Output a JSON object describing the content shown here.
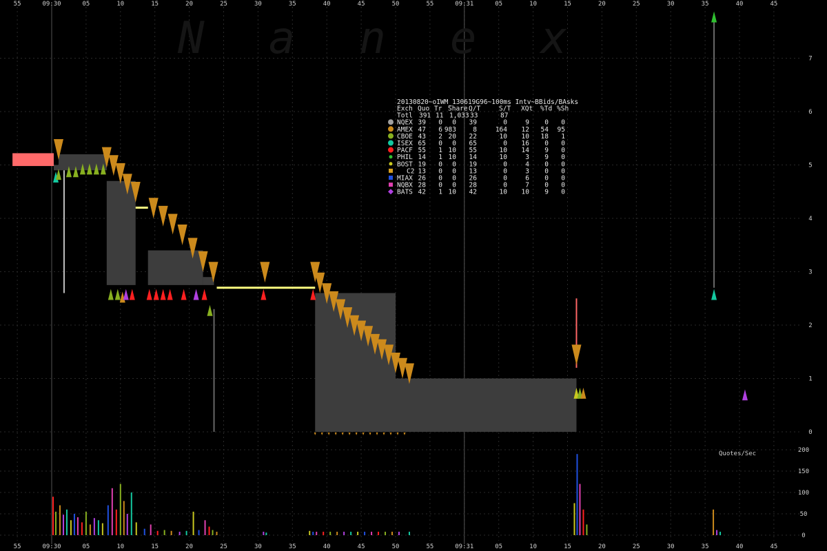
{
  "chart_data": {
    "type": "table",
    "watermark": "N a n e x",
    "time_axis": {
      "labels": [
        "55",
        "09:30",
        "05",
        "10",
        "15",
        "20",
        "25",
        "30",
        "35",
        "40",
        "45",
        "50",
        "55",
        "09:31",
        "05",
        "10",
        "15",
        "20",
        "25",
        "30",
        "35",
        "40",
        "45"
      ],
      "minor_labels_seconds": [
        -5,
        0,
        5,
        10,
        15,
        20,
        25,
        30,
        35,
        40,
        45,
        50,
        55,
        60,
        65,
        70,
        75,
        80,
        85,
        90,
        95,
        100,
        105
      ],
      "range_seconds": [
        -7,
        112
      ],
      "minute_markers": [
        0,
        60
      ]
    },
    "price_axis": {
      "ticks": [
        "0",
        "1",
        "2",
        "3",
        "4",
        "5",
        "6",
        "7"
      ],
      "range": [
        0,
        7.8
      ]
    },
    "rate_axis": {
      "title": "Quotes/Sec",
      "ticks": [
        "0",
        "50",
        "100",
        "150",
        "200"
      ],
      "range": [
        0,
        205
      ]
    },
    "legend": {
      "title": "20130820~oIWM_130619G96~100ms Intv~BBids/BAsks",
      "header": [
        "Exch",
        "Quo",
        "Tr",
        "Share",
        "Q/T",
        "S/T",
        "XQt",
        "%Td",
        "%Sh"
      ],
      "total_row": [
        "Totl",
        "391",
        "11",
        "1,033",
        "33",
        "87",
        "",
        "",
        ""
      ],
      "rows": [
        {
          "exch": "NQEX",
          "cells": [
            "39",
            "0",
            "0",
            "39",
            "0",
            "9",
            "0",
            "0"
          ],
          "color": "#a0a0a0",
          "marker": "circle"
        },
        {
          "exch": "AMEX",
          "cells": [
            "47",
            "6",
            "983",
            "8",
            "164",
            "12",
            "54",
            "95"
          ],
          "color": "#cc8a1c",
          "marker": "circle"
        },
        {
          "exch": "CBOE",
          "cells": [
            "43",
            "2",
            "20",
            "22",
            "10",
            "10",
            "18",
            "1"
          ],
          "color": "#88b020",
          "marker": "circle"
        },
        {
          "exch": "ISEX",
          "cells": [
            "65",
            "0",
            "0",
            "65",
            "0",
            "16",
            "0",
            "0"
          ],
          "color": "#14c8a0",
          "marker": "circle"
        },
        {
          "exch": "PACF",
          "cells": [
            "55",
            "1",
            "10",
            "55",
            "10",
            "14",
            "9",
            "0"
          ],
          "color": "#ff2020",
          "marker": "circle"
        },
        {
          "exch": "PHIL",
          "cells": [
            "14",
            "1",
            "10",
            "14",
            "10",
            "3",
            "9",
            "0"
          ],
          "color": "#30c030",
          "marker": "dot"
        },
        {
          "exch": "BOST",
          "cells": [
            "19",
            "0",
            "0",
            "19",
            "0",
            "4",
            "0",
            "0"
          ],
          "color": "#c8c820",
          "marker": "dot"
        },
        {
          "exch": "C2",
          "cells": [
            "13",
            "0",
            "0",
            "13",
            "0",
            "3",
            "0",
            "0"
          ],
          "color": "#d8a020",
          "marker": "square"
        },
        {
          "exch": "MIAX",
          "cells": [
            "26",
            "0",
            "0",
            "26",
            "0",
            "6",
            "0",
            "0"
          ],
          "color": "#2050e0",
          "marker": "square"
        },
        {
          "exch": "NQBX",
          "cells": [
            "28",
            "0",
            "0",
            "28",
            "0",
            "7",
            "0",
            "0"
          ],
          "color": "#e040b0",
          "marker": "square"
        },
        {
          "exch": "BATS",
          "cells": [
            "42",
            "1",
            "10",
            "42",
            "10",
            "10",
            "9",
            "0"
          ],
          "color": "#b040e0",
          "marker": "diamond"
        }
      ]
    },
    "nbbo_bands": [
      {
        "t0": 0.3,
        "t1": 1.0,
        "bid": 4.9,
        "ask": 5.0
      },
      {
        "t0": 1.0,
        "t1": 8.0,
        "bid": 4.9,
        "ask": 5.2
      },
      {
        "t0": 8.0,
        "t1": 12.2,
        "bid": 2.75,
        "ask": 4.7
      },
      {
        "t0": 14.0,
        "t1": 22.0,
        "bid": 2.75,
        "ask": 3.4
      },
      {
        "t0": 22.0,
        "t1": 23.6,
        "bid": 2.75,
        "ask": 2.9
      },
      {
        "t0": 38.3,
        "t1": 50.0,
        "bid": 0.0,
        "ask": 2.6
      },
      {
        "t0": 50.0,
        "t1": 76.3,
        "bid": 0.0,
        "ask": 1.0
      }
    ],
    "ask_steps": [
      {
        "t": 1.0,
        "p": 5.2
      },
      {
        "t": 8.0,
        "p": 5.05
      },
      {
        "t": 9.0,
        "p": 4.9
      },
      {
        "t": 10.0,
        "p": 4.75
      },
      {
        "t": 11.0,
        "p": 4.55
      },
      {
        "t": 12.2,
        "p": 4.4
      },
      {
        "t": 14.8,
        "p": 4.1
      },
      {
        "t": 16.2,
        "p": 3.95
      },
      {
        "t": 17.6,
        "p": 3.8
      },
      {
        "t": 19.0,
        "p": 3.6
      },
      {
        "t": 20.5,
        "p": 3.35
      },
      {
        "t": 22.0,
        "p": 3.1
      },
      {
        "t": 23.5,
        "p": 2.9
      },
      {
        "t": 31.0,
        "p": 2.9
      },
      {
        "t": 38.3,
        "p": 2.9
      },
      {
        "t": 39.0,
        "p": 2.7
      },
      {
        "t": 40.0,
        "p": 2.5
      },
      {
        "t": 41.0,
        "p": 2.35
      },
      {
        "t": 42.0,
        "p": 2.2
      },
      {
        "t": 43.0,
        "p": 2.05
      },
      {
        "t": 44.0,
        "p": 1.9
      },
      {
        "t": 45.0,
        "p": 1.8
      },
      {
        "t": 46.0,
        "p": 1.7
      },
      {
        "t": 47.0,
        "p": 1.55
      },
      {
        "t": 48.0,
        "p": 1.45
      },
      {
        "t": 49.0,
        "p": 1.35
      },
      {
        "t": 50.0,
        "p": 1.2
      },
      {
        "t": 51.0,
        "p": 1.1
      },
      {
        "t": 52.0,
        "p": 1.0
      },
      {
        "t": 76.3,
        "p": 1.35
      }
    ],
    "spans": [
      {
        "t": 1.8,
        "p0": 2.6,
        "p1": 4.9,
        "color": "#c0c0c0"
      },
      {
        "t": 23.6,
        "p0": 0.0,
        "p1": 2.3,
        "color": "#666666"
      },
      {
        "t": 76.3,
        "p0": 1.2,
        "p1": 2.5,
        "color": "#ff6666"
      },
      {
        "t": 96.3,
        "p0": 2.7,
        "p1": 7.7,
        "color": "#6a6a6a"
      }
    ],
    "yellow_lines": [
      {
        "t0": 12.2,
        "t1": 14.0,
        "p": 4.2
      },
      {
        "t0": 24.0,
        "t1": 38.3,
        "p": 2.7
      }
    ],
    "opening_block": {
      "t0": -5.7,
      "t1": 0.3,
      "bid": 4.98,
      "ask": 5.22,
      "color": "#ff6a6a"
    },
    "bid_markers": [
      {
        "t": 0.6,
        "p": 4.8,
        "color": "#14c8a0"
      },
      {
        "t": 1.0,
        "p": 4.85,
        "color": "#88b020"
      },
      {
        "t": 2.5,
        "p": 4.9,
        "color": "#88b020"
      },
      {
        "t": 3.5,
        "p": 4.9,
        "color": "#88b020"
      },
      {
        "t": 4.5,
        "p": 4.95,
        "color": "#88b020"
      },
      {
        "t": 5.5,
        "p": 4.95,
        "color": "#88b020"
      },
      {
        "t": 6.5,
        "p": 4.95,
        "color": "#88b020"
      },
      {
        "t": 7.5,
        "p": 4.95,
        "color": "#88b020"
      },
      {
        "t": 8.6,
        "p": 2.6,
        "color": "#88b020"
      },
      {
        "t": 9.6,
        "p": 2.6,
        "color": "#88b020"
      },
      {
        "t": 10.3,
        "p": 2.55,
        "color": "#cc8a1c"
      },
      {
        "t": 10.8,
        "p": 2.6,
        "color": "#b040e0"
      },
      {
        "t": 11.7,
        "p": 2.6,
        "color": "#ff2020"
      },
      {
        "t": 14.2,
        "p": 2.6,
        "color": "#ff2020"
      },
      {
        "t": 15.2,
        "p": 2.6,
        "color": "#ff2020"
      },
      {
        "t": 16.2,
        "p": 2.6,
        "color": "#ff2020"
      },
      {
        "t": 17.2,
        "p": 2.6,
        "color": "#ff2020"
      },
      {
        "t": 19.2,
        "p": 2.6,
        "color": "#ff2020"
      },
      {
        "t": 21.0,
        "p": 2.6,
        "color": "#b040e0"
      },
      {
        "t": 22.2,
        "p": 2.6,
        "color": "#ff2020"
      },
      {
        "t": 23.0,
        "p": 2.3,
        "color": "#88b020"
      },
      {
        "t": 30.8,
        "p": 2.6,
        "color": "#ff2020"
      },
      {
        "t": 38.0,
        "p": 2.6,
        "color": "#ff2020"
      },
      {
        "t": 76.3,
        "p": 0.75,
        "color": "#c8c820"
      },
      {
        "t": 76.8,
        "p": 0.75,
        "color": "#88b020"
      },
      {
        "t": 77.3,
        "p": 0.75,
        "color": "#cc8a1c"
      },
      {
        "t": 96.3,
        "p": 2.6,
        "color": "#14c8a0"
      },
      {
        "t": 96.3,
        "p": 7.8,
        "color": "#30c030"
      },
      {
        "t": 100.8,
        "p": 0.72,
        "color": "#b040e0"
      }
    ],
    "rate_bars": [
      {
        "t": 0.2,
        "v": 90
      },
      {
        "t": 0.6,
        "v": 55
      },
      {
        "t": 1.2,
        "v": 70
      },
      {
        "t": 1.7,
        "v": 48
      },
      {
        "t": 2.2,
        "v": 60
      },
      {
        "t": 2.8,
        "v": 35
      },
      {
        "t": 3.3,
        "v": 50
      },
      {
        "t": 3.8,
        "v": 42
      },
      {
        "t": 4.4,
        "v": 30
      },
      {
        "t": 5.0,
        "v": 55
      },
      {
        "t": 5.6,
        "v": 25
      },
      {
        "t": 6.2,
        "v": 40
      },
      {
        "t": 6.8,
        "v": 35
      },
      {
        "t": 7.4,
        "v": 28
      },
      {
        "t": 8.2,
        "v": 70
      },
      {
        "t": 8.8,
        "v": 110
      },
      {
        "t": 9.4,
        "v": 60
      },
      {
        "t": 10.0,
        "v": 120
      },
      {
        "t": 10.5,
        "v": 80
      },
      {
        "t": 11.0,
        "v": 50
      },
      {
        "t": 11.6,
        "v": 100
      },
      {
        "t": 12.3,
        "v": 30
      },
      {
        "t": 13.5,
        "v": 15
      },
      {
        "t": 14.4,
        "v": 25
      },
      {
        "t": 15.4,
        "v": 10
      },
      {
        "t": 16.4,
        "v": 12
      },
      {
        "t": 17.4,
        "v": 10
      },
      {
        "t": 18.6,
        "v": 8
      },
      {
        "t": 19.6,
        "v": 10
      },
      {
        "t": 20.6,
        "v": 55
      },
      {
        "t": 21.4,
        "v": 12
      },
      {
        "t": 22.3,
        "v": 35
      },
      {
        "t": 22.9,
        "v": 20
      },
      {
        "t": 23.4,
        "v": 12
      },
      {
        "t": 24.0,
        "v": 8
      },
      {
        "t": 30.8,
        "v": 8
      },
      {
        "t": 31.2,
        "v": 6
      },
      {
        "t": 37.5,
        "v": 10
      },
      {
        "t": 38.0,
        "v": 8
      },
      {
        "t": 38.5,
        "v": 8
      },
      {
        "t": 39.5,
        "v": 8
      },
      {
        "t": 40.5,
        "v": 8
      },
      {
        "t": 41.5,
        "v": 8
      },
      {
        "t": 42.5,
        "v": 8
      },
      {
        "t": 43.5,
        "v": 8
      },
      {
        "t": 44.5,
        "v": 8
      },
      {
        "t": 45.5,
        "v": 8
      },
      {
        "t": 46.5,
        "v": 8
      },
      {
        "t": 47.5,
        "v": 8
      },
      {
        "t": 48.5,
        "v": 8
      },
      {
        "t": 49.5,
        "v": 8
      },
      {
        "t": 50.5,
        "v": 8
      },
      {
        "t": 52.0,
        "v": 8
      },
      {
        "t": 76.0,
        "v": 75
      },
      {
        "t": 76.4,
        "v": 190
      },
      {
        "t": 76.8,
        "v": 120
      },
      {
        "t": 77.3,
        "v": 60
      },
      {
        "t": 77.8,
        "v": 25
      },
      {
        "t": 96.2,
        "v": 60
      },
      {
        "t": 96.7,
        "v": 12
      },
      {
        "t": 97.2,
        "v": 8
      }
    ]
  }
}
